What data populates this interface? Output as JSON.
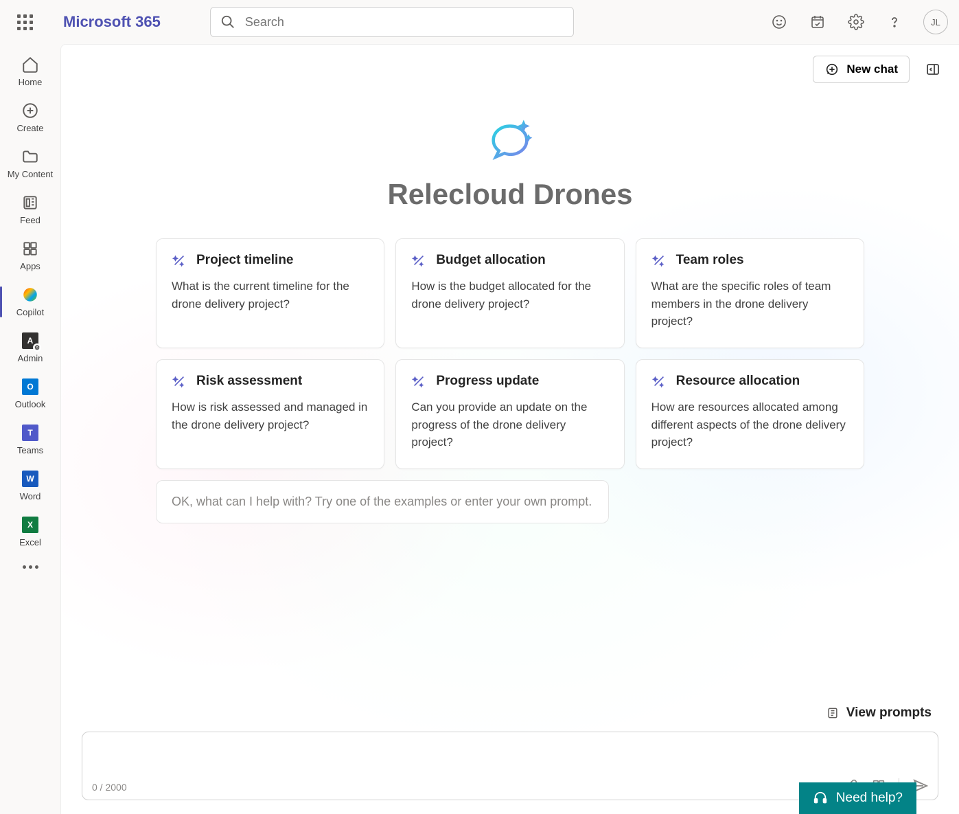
{
  "header": {
    "brand": "Microsoft 365",
    "search_placeholder": "Search",
    "avatar_initials": "JL"
  },
  "sidebar": {
    "items": [
      {
        "key": "home",
        "label": "Home"
      },
      {
        "key": "create",
        "label": "Create"
      },
      {
        "key": "mycontent",
        "label": "My Content"
      },
      {
        "key": "feed",
        "label": "Feed"
      },
      {
        "key": "apps",
        "label": "Apps"
      },
      {
        "key": "copilot",
        "label": "Copilot"
      },
      {
        "key": "admin",
        "label": "Admin"
      },
      {
        "key": "outlook",
        "label": "Outlook"
      },
      {
        "key": "teams",
        "label": "Teams"
      },
      {
        "key": "word",
        "label": "Word"
      },
      {
        "key": "excel",
        "label": "Excel"
      }
    ]
  },
  "main": {
    "new_chat_label": "New chat",
    "hero_title": "Relecloud Drones",
    "cards": [
      {
        "title": "Project timeline",
        "body": "What is the current timeline for the drone delivery project?"
      },
      {
        "title": "Budget allocation",
        "body": "How is the budget allocated for the drone delivery project?"
      },
      {
        "title": "Team roles",
        "body": "What are the specific roles of team members in the drone delivery project?"
      },
      {
        "title": "Risk assessment",
        "body": "How is risk assessed and managed in the drone delivery project?"
      },
      {
        "title": "Progress update",
        "body": "Can you provide an update on the progress of the drone delivery project?"
      },
      {
        "title": "Resource allocation",
        "body": "How are resources allocated among different aspects of the drone delivery project?"
      }
    ],
    "helper_text": "OK, what can I help with? Try one of the examples or enter your own prompt.",
    "view_prompts_label": "View prompts",
    "counter": "0 / 2000",
    "need_help_label": "Need help?"
  }
}
